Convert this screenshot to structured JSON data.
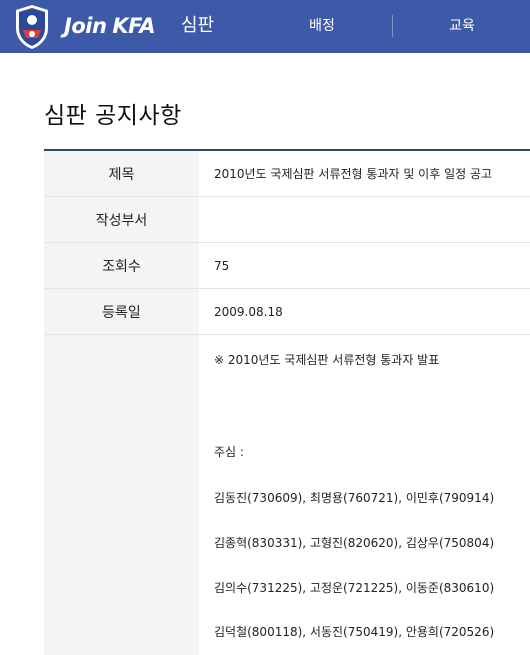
{
  "header": {
    "logo_text_join": "Join",
    "logo_text_kfa": "KFA",
    "section": "심판",
    "nav": [
      "배정",
      "교육"
    ]
  },
  "page": {
    "title": "심판 공지사항"
  },
  "table": {
    "rows": [
      {
        "label": "제목",
        "value": "2010년도 국제심판 서류전형 통과자 및 이후 일정 공고"
      },
      {
        "label": "작성부서",
        "value": ""
      },
      {
        "label": "조회수",
        "value": "75"
      },
      {
        "label": "등록일",
        "value": "2009.08.18"
      }
    ],
    "content": [
      "※ 2010년도 국제심판 서류전형 통과자 발표",
      "주심 :",
      "김동진(730609), 최명용(760721), 이민후(790914)",
      "김종혁(830331), 고형진(820620), 김상우(750804)",
      "김의수(731225), 고정운(721225), 이동준(830610)",
      "김덕철(800118), 서동진(750419), 안용희(720526)"
    ]
  },
  "colors": {
    "header_bg": "#3d5aa8",
    "table_top_border": "#2b4a5e",
    "label_bg": "#f4f4f4"
  }
}
